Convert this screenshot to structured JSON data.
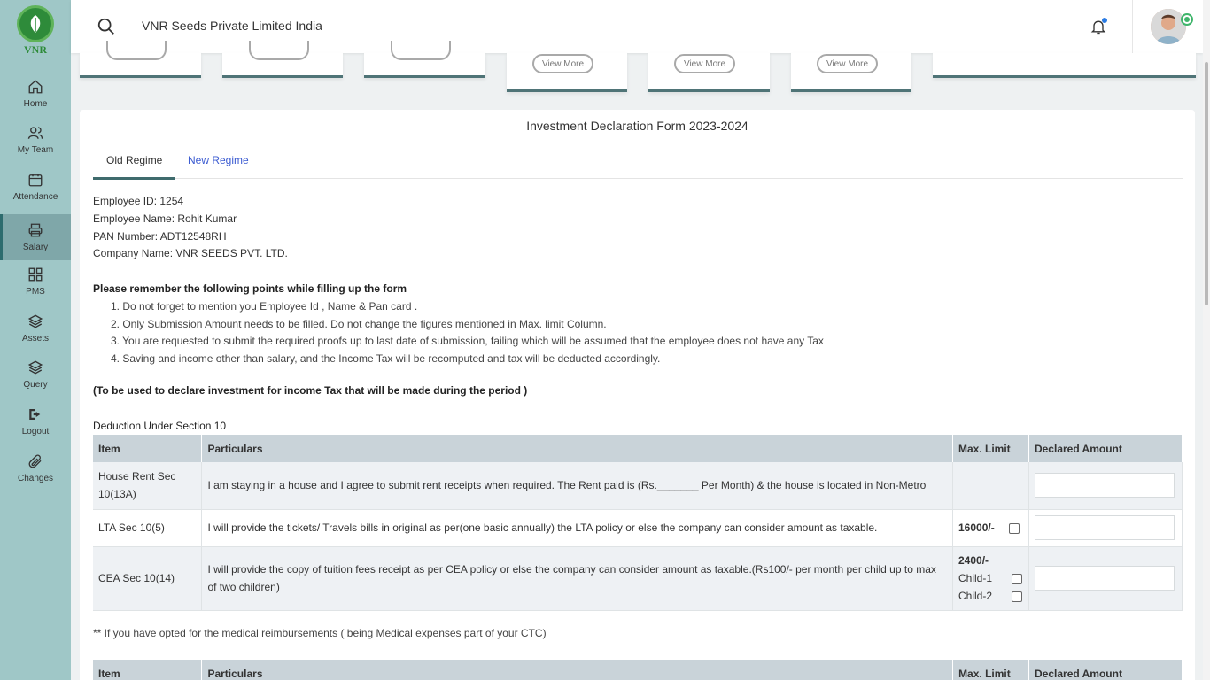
{
  "app": {
    "logo_text": "VNR",
    "company_name": "VNR Seeds Private Limited India"
  },
  "sidebar": {
    "items": [
      {
        "label": "Home",
        "icon": "home-icon"
      },
      {
        "label": "My Team",
        "icon": "team-icon"
      },
      {
        "label": "Attendance",
        "icon": "calendar-icon"
      },
      {
        "label": "Salary",
        "icon": "printer-icon",
        "active": true
      },
      {
        "label": "PMS",
        "icon": "grid-icon"
      },
      {
        "label": "Assets",
        "icon": "layers-icon"
      },
      {
        "label": "Query",
        "icon": "layers-icon"
      },
      {
        "label": "Logout",
        "icon": "logout-icon"
      },
      {
        "label": "Changes",
        "icon": "paperclip-icon"
      }
    ]
  },
  "cards": {
    "view_more": "View More"
  },
  "form": {
    "title": "Investment Declaration Form 2023-2024",
    "tabs": [
      "Old Regime",
      "New Regime"
    ],
    "employee_id": "Employee ID: 1254",
    "employee_name": "Employee Name: Rohit Kumar",
    "pan_number": "PAN Number: ADT12548RH",
    "company_name": "Company Name: VNR SEEDS PVT. LTD.",
    "remember_heading": "Please remember the following points while filling up the form",
    "points": [
      "1. Do not forget to mention you Employee Id , Name & Pan card .",
      "2. Only Submission Amount needs to be filled. Do not change the figures mentioned in Max. limit Column.",
      "3. You are requested to submit the required proofs up to last date of submission, failing which will be assumed that the employee does not have any Tax",
      "4. Saving and income other than salary, and the Income Tax will be recomputed and tax will be deducted accordingly."
    ],
    "period_note": "(To be used to declare investment for income Tax that will be made during the period )",
    "section_heading": "Deduction Under Section 10",
    "table_headers": [
      "Item",
      "Particulars",
      "Max. Limit",
      "Declared Amount"
    ],
    "rows": [
      {
        "item": "House Rent Sec 10(13A)",
        "particulars": "I am staying in a house and I agree to submit rent receipts when required. The Rent paid is (Rs._______ Per Month) & the house is located in Non-Metro",
        "limit": ""
      },
      {
        "item": "LTA Sec 10(5)",
        "particulars": "I will provide the tickets/ Travels bills in original as per(one basic annually) the LTA policy or else the company can consider amount as taxable.",
        "limit": "16000/-"
      },
      {
        "item": "CEA Sec 10(14)",
        "particulars": "I will provide the copy of tuition fees receipt as per CEA policy or else the company can consider amount as taxable.(Rs100/- per month per child up to max of two children)",
        "limit": "2400/-",
        "child1": "Child-1",
        "child2": "Child-2"
      }
    ],
    "medical_note": "** If you have opted for the medical reimbursements ( being Medical expenses part of your CTC)",
    "table2_headers": [
      "Item",
      "Particulars",
      "Max. Limit",
      "Declared Amount"
    ]
  }
}
